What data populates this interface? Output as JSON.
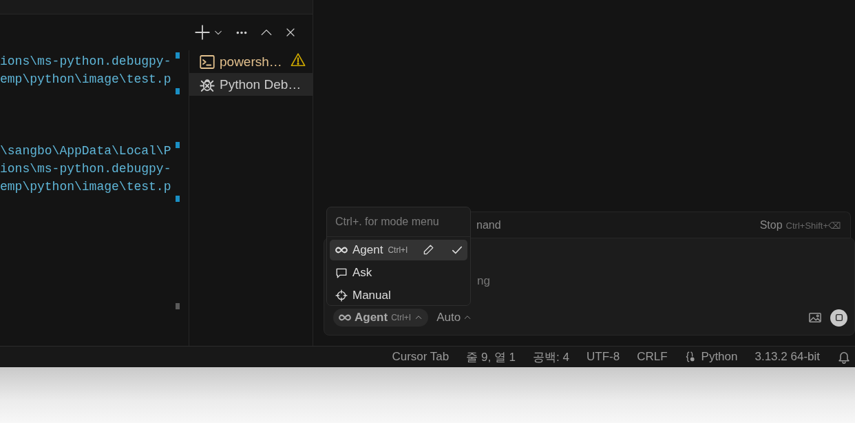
{
  "terminal": {
    "lines": [
      {
        "kind": "command",
        "text": "ions\\ms-python.debugpy-"
      },
      {
        "kind": "output",
        "text": "emp\\python\\image\\test.p"
      },
      {
        "kind": "prompt"
      },
      {
        "kind": "blank"
      },
      {
        "kind": "blank"
      },
      {
        "kind": "command",
        "text": "\\sangbo\\AppData\\Local\\P"
      },
      {
        "kind": "output",
        "text": "ions\\ms-python.debugpy-"
      },
      {
        "kind": "output",
        "text": "emp\\python\\image\\test.p"
      },
      {
        "kind": "prompt"
      },
      {
        "kind": "blank"
      },
      {
        "kind": "blank"
      },
      {
        "kind": "blank"
      },
      {
        "kind": "blank"
      },
      {
        "kind": "blank"
      },
      {
        "kind": "pending"
      }
    ],
    "instances": [
      {
        "label": "powersh…",
        "kind": "shell",
        "warning": true,
        "selected": false
      },
      {
        "label": "Python Deb…",
        "kind": "debug",
        "warning": false,
        "selected": true
      }
    ]
  },
  "composer": {
    "header_text": "nand",
    "stop_label": "Stop",
    "stop_shortcut": "Ctrl+Shift+⌫",
    "placeholder_fragment": "ng",
    "mode_button": {
      "label": "Agent",
      "shortcut": "Ctrl+I"
    },
    "model_button": {
      "label": "Auto"
    },
    "mode_menu": {
      "hint": "Ctrl+. for mode menu",
      "items": [
        {
          "kind": "agent",
          "label": "Agent",
          "shortcut": "Ctrl+I",
          "selected": true
        },
        {
          "kind": "ask",
          "label": "Ask",
          "selected": false
        },
        {
          "kind": "manual",
          "label": "Manual",
          "selected": false
        }
      ]
    }
  },
  "status_bar": [
    "Cursor Tab",
    "줄 9, 열 1",
    "공백: 4",
    "UTF-8",
    "CRLF",
    "Python",
    "3.13.2 64-bit"
  ]
}
